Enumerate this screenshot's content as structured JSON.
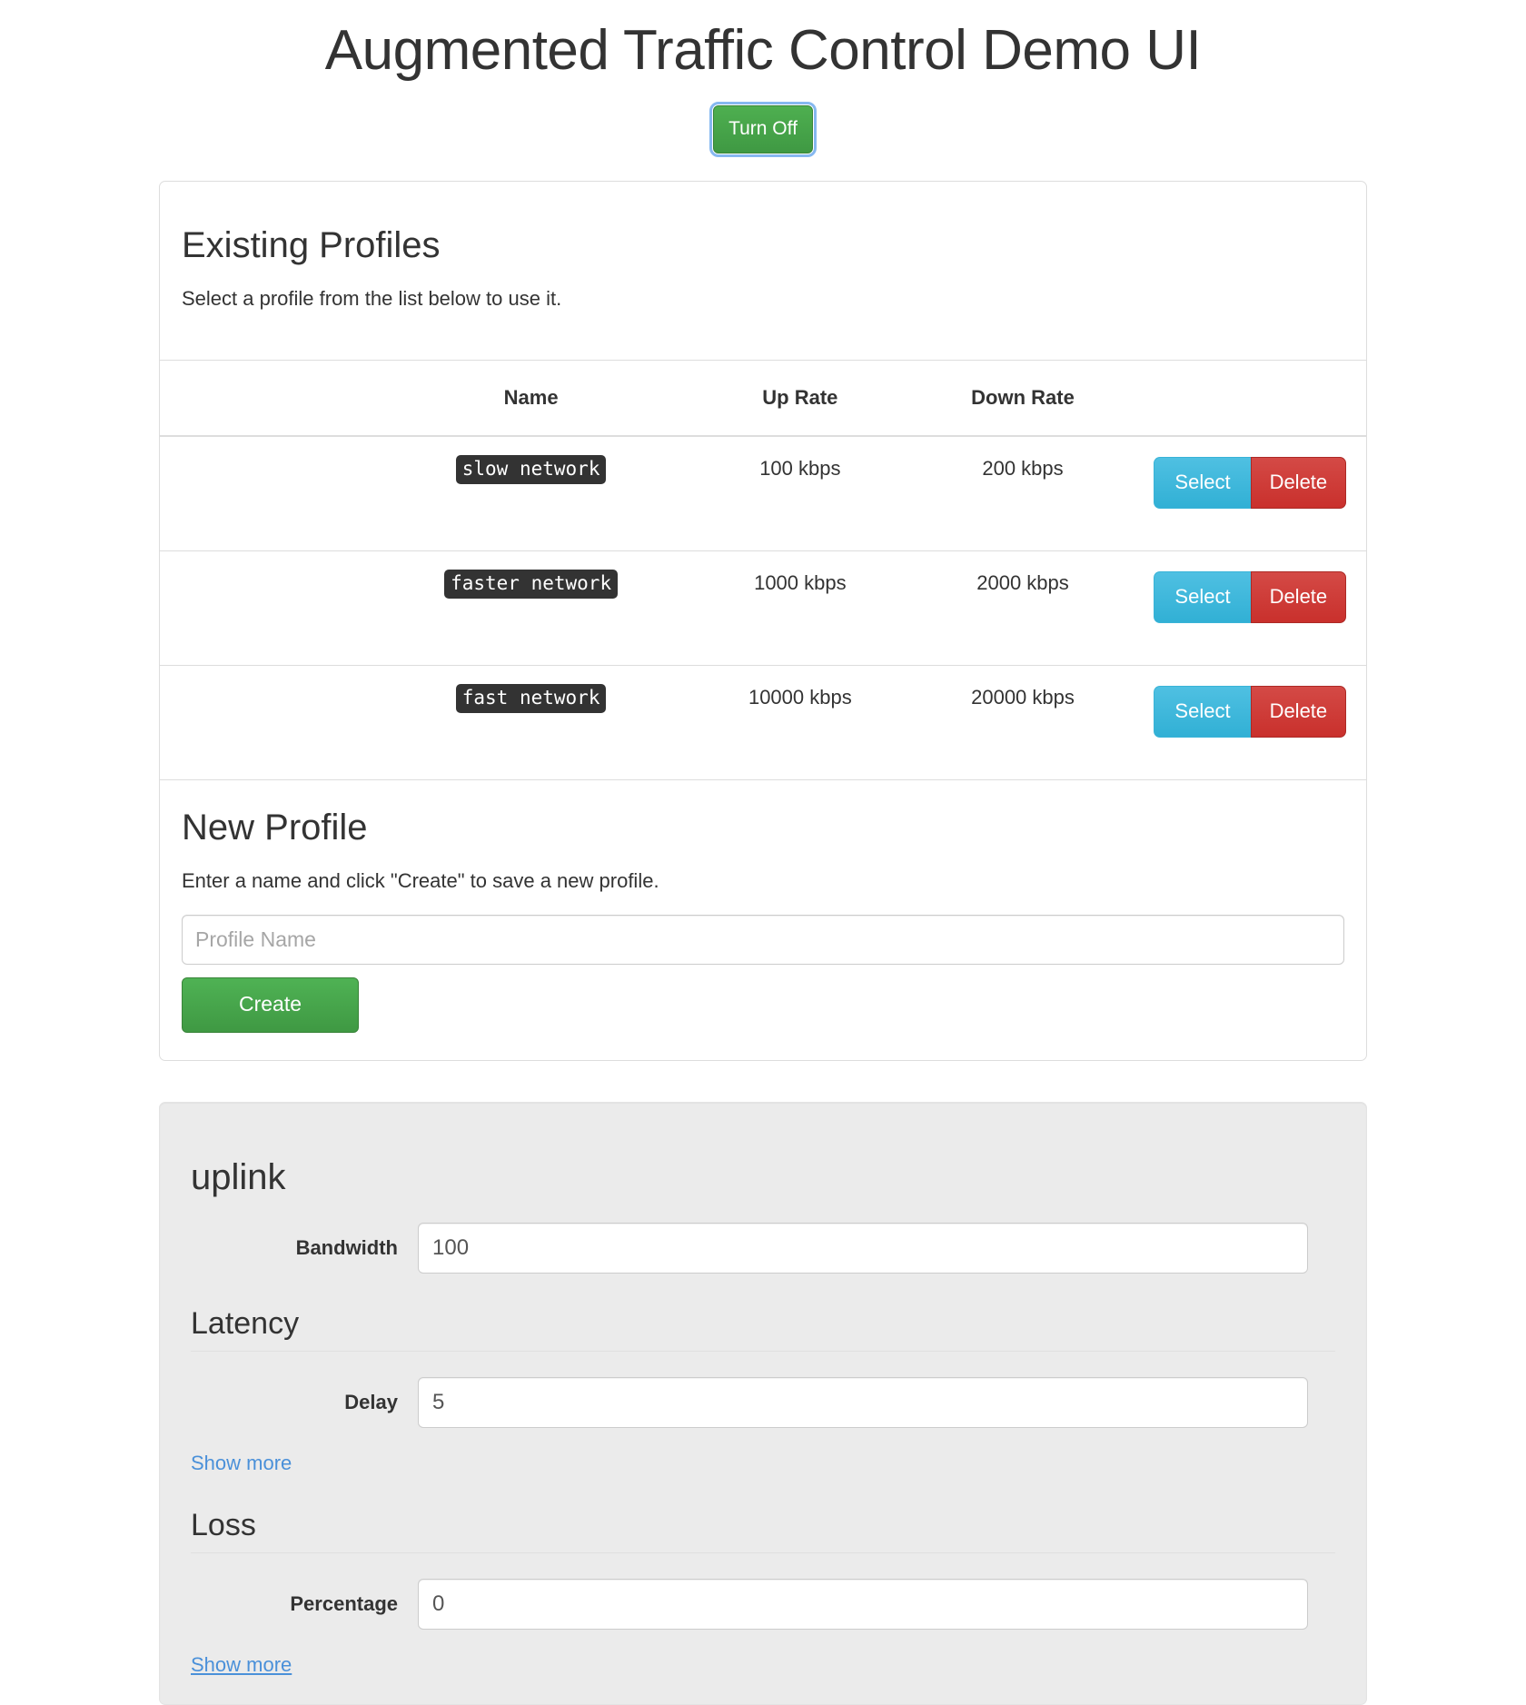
{
  "header": {
    "title": "Augmented Traffic Control Demo UI",
    "toggle_button_label": "Turn Off"
  },
  "existing_profiles": {
    "title": "Existing Profiles",
    "description": "Select a profile from the list below to use it.",
    "columns": [
      "Name",
      "Up Rate",
      "Down Rate"
    ],
    "rows": [
      {
        "name": "slow network",
        "up_rate": "100 kbps",
        "down_rate": "200 kbps",
        "select_label": "Select",
        "delete_label": "Delete"
      },
      {
        "name": "faster network",
        "up_rate": "1000 kbps",
        "down_rate": "2000 kbps",
        "select_label": "Select",
        "delete_label": "Delete"
      },
      {
        "name": "fast network",
        "up_rate": "10000 kbps",
        "down_rate": "20000 kbps",
        "select_label": "Select",
        "delete_label": "Delete"
      }
    ]
  },
  "new_profile": {
    "title": "New Profile",
    "description": "Enter a name and click \"Create\" to save a new profile.",
    "input_placeholder": "Profile Name",
    "input_value": "",
    "create_label": "Create"
  },
  "uplink": {
    "title": "uplink",
    "bandwidth": {
      "label": "Bandwidth",
      "value": "100"
    },
    "latency": {
      "group_title": "Latency",
      "delay": {
        "label": "Delay",
        "value": "5"
      },
      "show_more_label": "Show more"
    },
    "loss": {
      "group_title": "Loss",
      "percentage": {
        "label": "Percentage",
        "value": "0"
      },
      "show_more_label": "Show more"
    }
  },
  "colors": {
    "green": "#449d44",
    "blue_select": "#46b8da",
    "red_delete": "#c9302c",
    "link_blue": "#4a90d9",
    "code_bg": "#333333",
    "focus_ring": "#86b8f0",
    "well_bg": "#ebebeb"
  }
}
